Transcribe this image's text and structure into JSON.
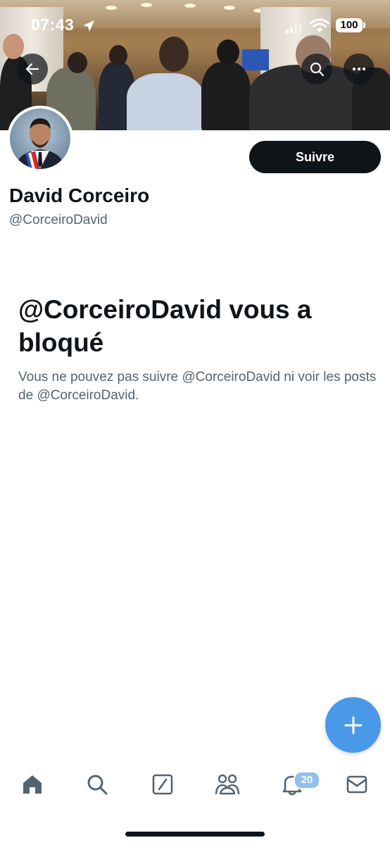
{
  "status_bar": {
    "time": "07:43",
    "battery": "100"
  },
  "profile": {
    "display_name": "David Corceiro",
    "handle": "@CorceiroDavid",
    "follow_label": "Suivre"
  },
  "blocked": {
    "title": "@CorceiroDavid vous a bloqué",
    "description": "Vous ne pouvez pas suivre @CorceiroDavid ni voir les posts de @CorceiroDavid."
  },
  "tabbar": {
    "notifications_badge": "20",
    "items": [
      "home-icon",
      "search-icon",
      "grok-icon",
      "communities-icon",
      "bell-icon",
      "mail-icon"
    ]
  },
  "colors": {
    "accent": "#4a99e9",
    "text_primary": "#0f1419",
    "text_secondary": "#536471"
  }
}
